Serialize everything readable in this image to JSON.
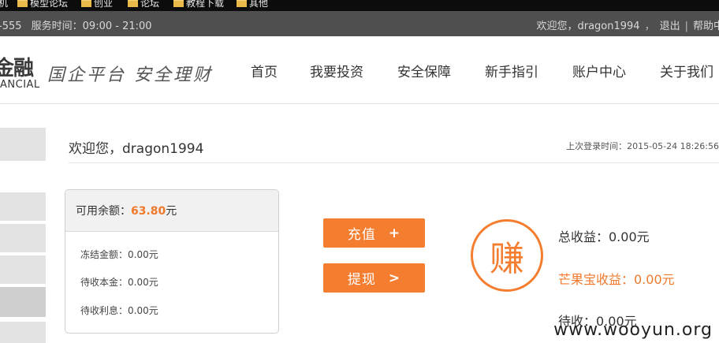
{
  "bookmarks": [
    {
      "label": "机"
    },
    {
      "label": "模型论坛"
    },
    {
      "label": "创业"
    },
    {
      "label": "论坛"
    },
    {
      "label": "教程下载"
    },
    {
      "label": "其他"
    }
  ],
  "topbar": {
    "hotline": "-555",
    "service_hours": "服务时间：09:00 - 21:00",
    "greeting": "欢迎您，dragon1994",
    "logout": "退出",
    "help": "帮助中"
  },
  "header": {
    "logo_cn": "金融",
    "logo_en": "ANCIAL",
    "slogan": "国企平台  安全理财",
    "nav": [
      {
        "label": "首页"
      },
      {
        "label": "我要投资"
      },
      {
        "label": "安全保障"
      },
      {
        "label": "新手指引"
      },
      {
        "label": "账户中心"
      },
      {
        "label": "关于我们"
      }
    ]
  },
  "account": {
    "welcome": "欢迎您，dragon1994",
    "last_login": "上次登录时间：2015-05-24 18:26:56",
    "available_label": "可用余额：",
    "available_amount": "63.80",
    "available_unit": "元",
    "rows": [
      {
        "label": "冻结金额：0.00元"
      },
      {
        "label": "待收本金：0.00元"
      },
      {
        "label": "待收利息：0.00元"
      }
    ],
    "recharge_label": "充值",
    "recharge_symbol": "+",
    "withdraw_label": "提现",
    "withdraw_symbol": ">",
    "earn_char": "赚",
    "total_income": "总收益：0.00元",
    "mango_income": "芒果宝收益：0.00元",
    "pending_income": "待收：0.00元"
  },
  "watermark": "www.wooyun.org",
  "colors": {
    "accent": "#f47d30",
    "topbar_bg": "#4f4f4f"
  }
}
